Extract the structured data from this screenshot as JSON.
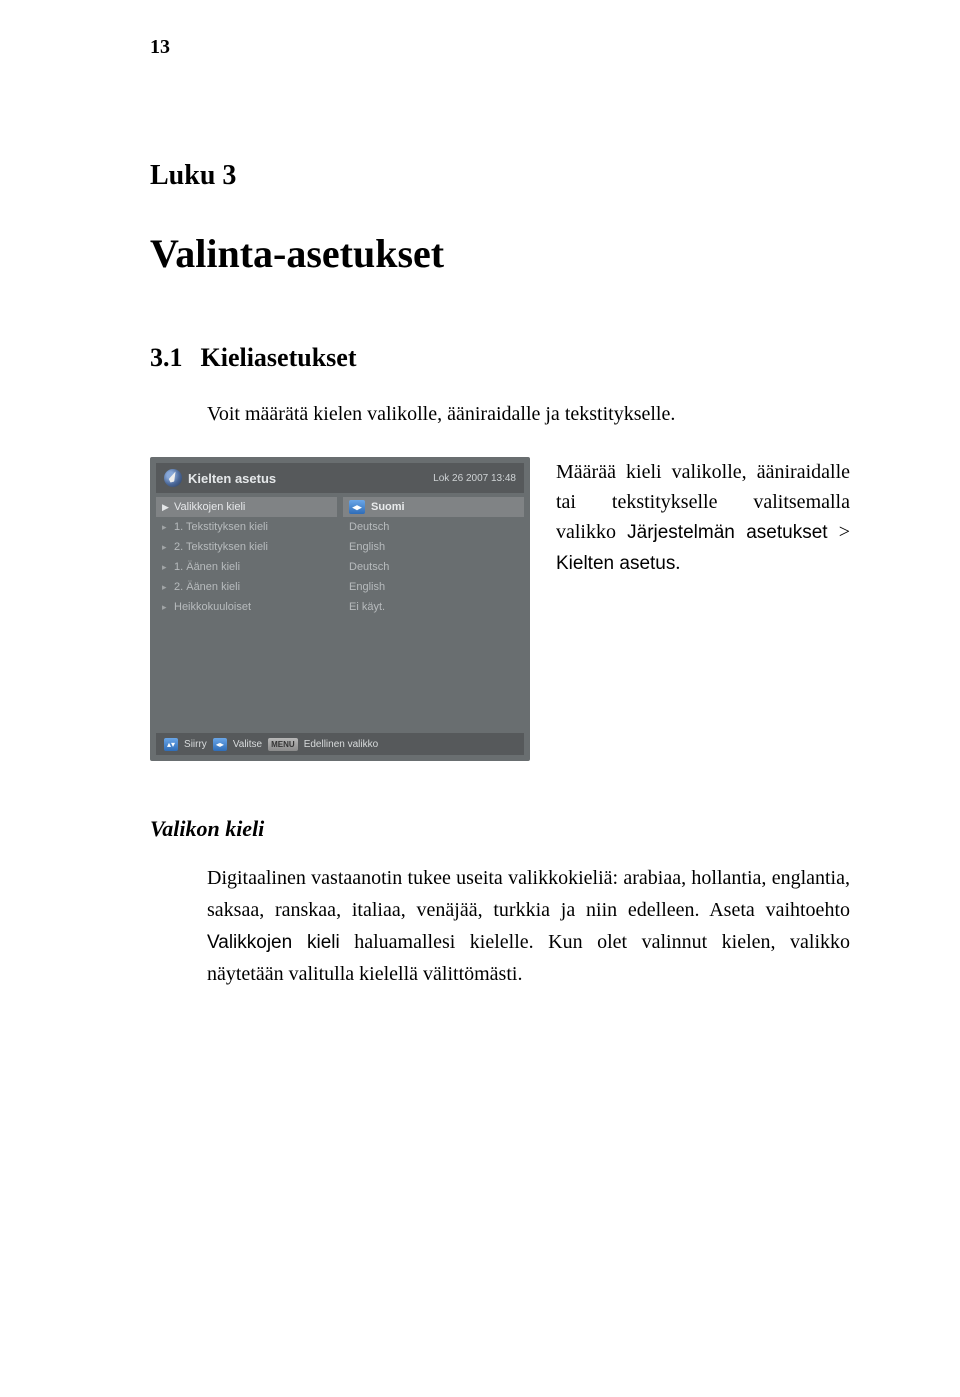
{
  "page_number": "13",
  "chapter_label": "Luku 3",
  "chapter_title": "Valinta-asetukset",
  "section": {
    "number": "3.1",
    "title": "Kieliasetukset"
  },
  "intro_text": "Voit määrätä kielen valikolle, ääniraidalle ja tekstitykselle.",
  "body_text": {
    "pre": "Määrää kieli valikolle, ääniraidalle tai tekstitykselle valitsemalla valikko ",
    "path1": "Järjestelmän asetukset",
    "sep": " > ",
    "path2": "Kielten asetus",
    "post": "."
  },
  "subheading": "Valikon kieli",
  "paragraph": {
    "pre": "Digitaalinen vastaanotin tukee useita valikkokieliä: arabiaa, hollantia, englantia, saksaa, ranskaa, italiaa, venäjää, turkkia ja niin edelleen. Aseta vaihtoehto ",
    "option": "Valikkojen kieli",
    "post": " haluamallesi kielelle. Kun olet valinnut kielen, valikko näytetään valitulla kielellä välittömästi."
  },
  "screenshot": {
    "title": "Kielten asetus",
    "date": "Lok 26 2007 13:48",
    "left_items": [
      "Valikkojen kieli",
      "1. Tekstityksen kieli",
      "2. Tekstityksen kieli",
      "1. Äänen kieli",
      "2. Äänen kieli",
      "Heikkokuuloiset"
    ],
    "right_items": [
      "Suomi",
      "Deutsch",
      "English",
      "Deutsch",
      "English",
      "Ei käyt."
    ],
    "footer": {
      "move": "Siirry",
      "select": "Valitse",
      "menu_key": "MENU",
      "back": "Edellinen valikko"
    }
  }
}
